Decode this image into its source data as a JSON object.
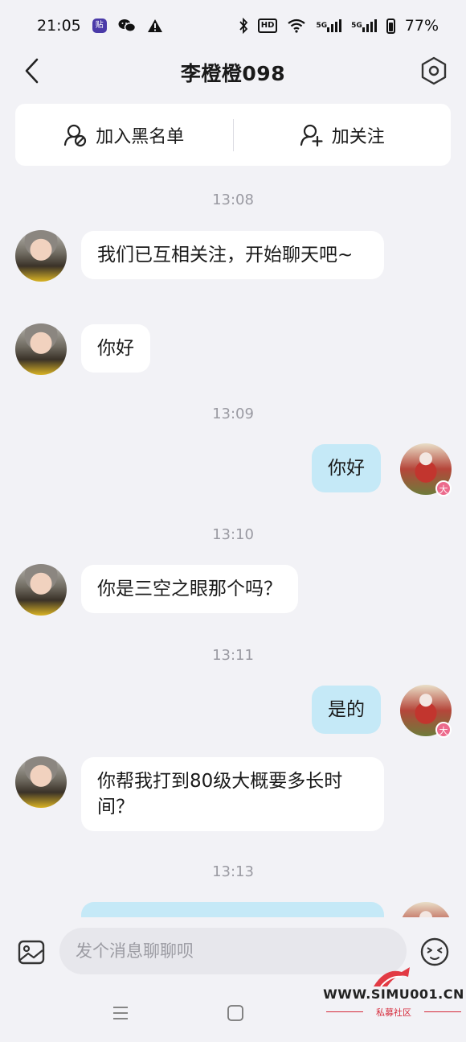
{
  "status_bar": {
    "time": "21:05",
    "app_badge": "贴",
    "network_1": "5G",
    "network_2": "5G",
    "battery": "77%",
    "hd_label": "HD",
    "icons": [
      "sticker-app-icon",
      "wechat-icon",
      "warning-icon",
      "bluetooth-icon",
      "hd-icon",
      "wifi-icon",
      "signal-icon",
      "battery-icon"
    ]
  },
  "header": {
    "title": "李橙橙098",
    "back_icon": "chevron-left-icon",
    "settings_icon": "settings-hexagon-icon"
  },
  "actions": {
    "block_label": "加入黑名单",
    "follow_label": "加关注"
  },
  "messages": [
    {
      "type": "timestamp",
      "text": "13:08"
    },
    {
      "type": "incoming",
      "text": "我们已互相关注，开始聊天吧~"
    },
    {
      "type": "incoming",
      "text": "你好"
    },
    {
      "type": "timestamp",
      "text": "13:09"
    },
    {
      "type": "outgoing",
      "text": "你好"
    },
    {
      "type": "timestamp",
      "text": "13:10"
    },
    {
      "type": "incoming",
      "text": "你是三空之眼那个吗？"
    },
    {
      "type": "timestamp",
      "text": "13:11"
    },
    {
      "type": "outgoing",
      "text": "是的"
    },
    {
      "type": "incoming",
      "text": "你帮我打到80级大概要多长时间？"
    },
    {
      "type": "timestamp",
      "text": "13:13"
    }
  ],
  "avatar_badge": "大",
  "input": {
    "placeholder": "发个消息聊聊呗"
  },
  "watermark": {
    "url": "WWW.SIMU001.CN",
    "subtitle": "私募社区"
  },
  "colors": {
    "background": "#f2f2f6",
    "incoming_bubble": "#ffffff",
    "outgoing_bubble": "#c5e9f7",
    "timestamp": "#9a9aa2"
  }
}
